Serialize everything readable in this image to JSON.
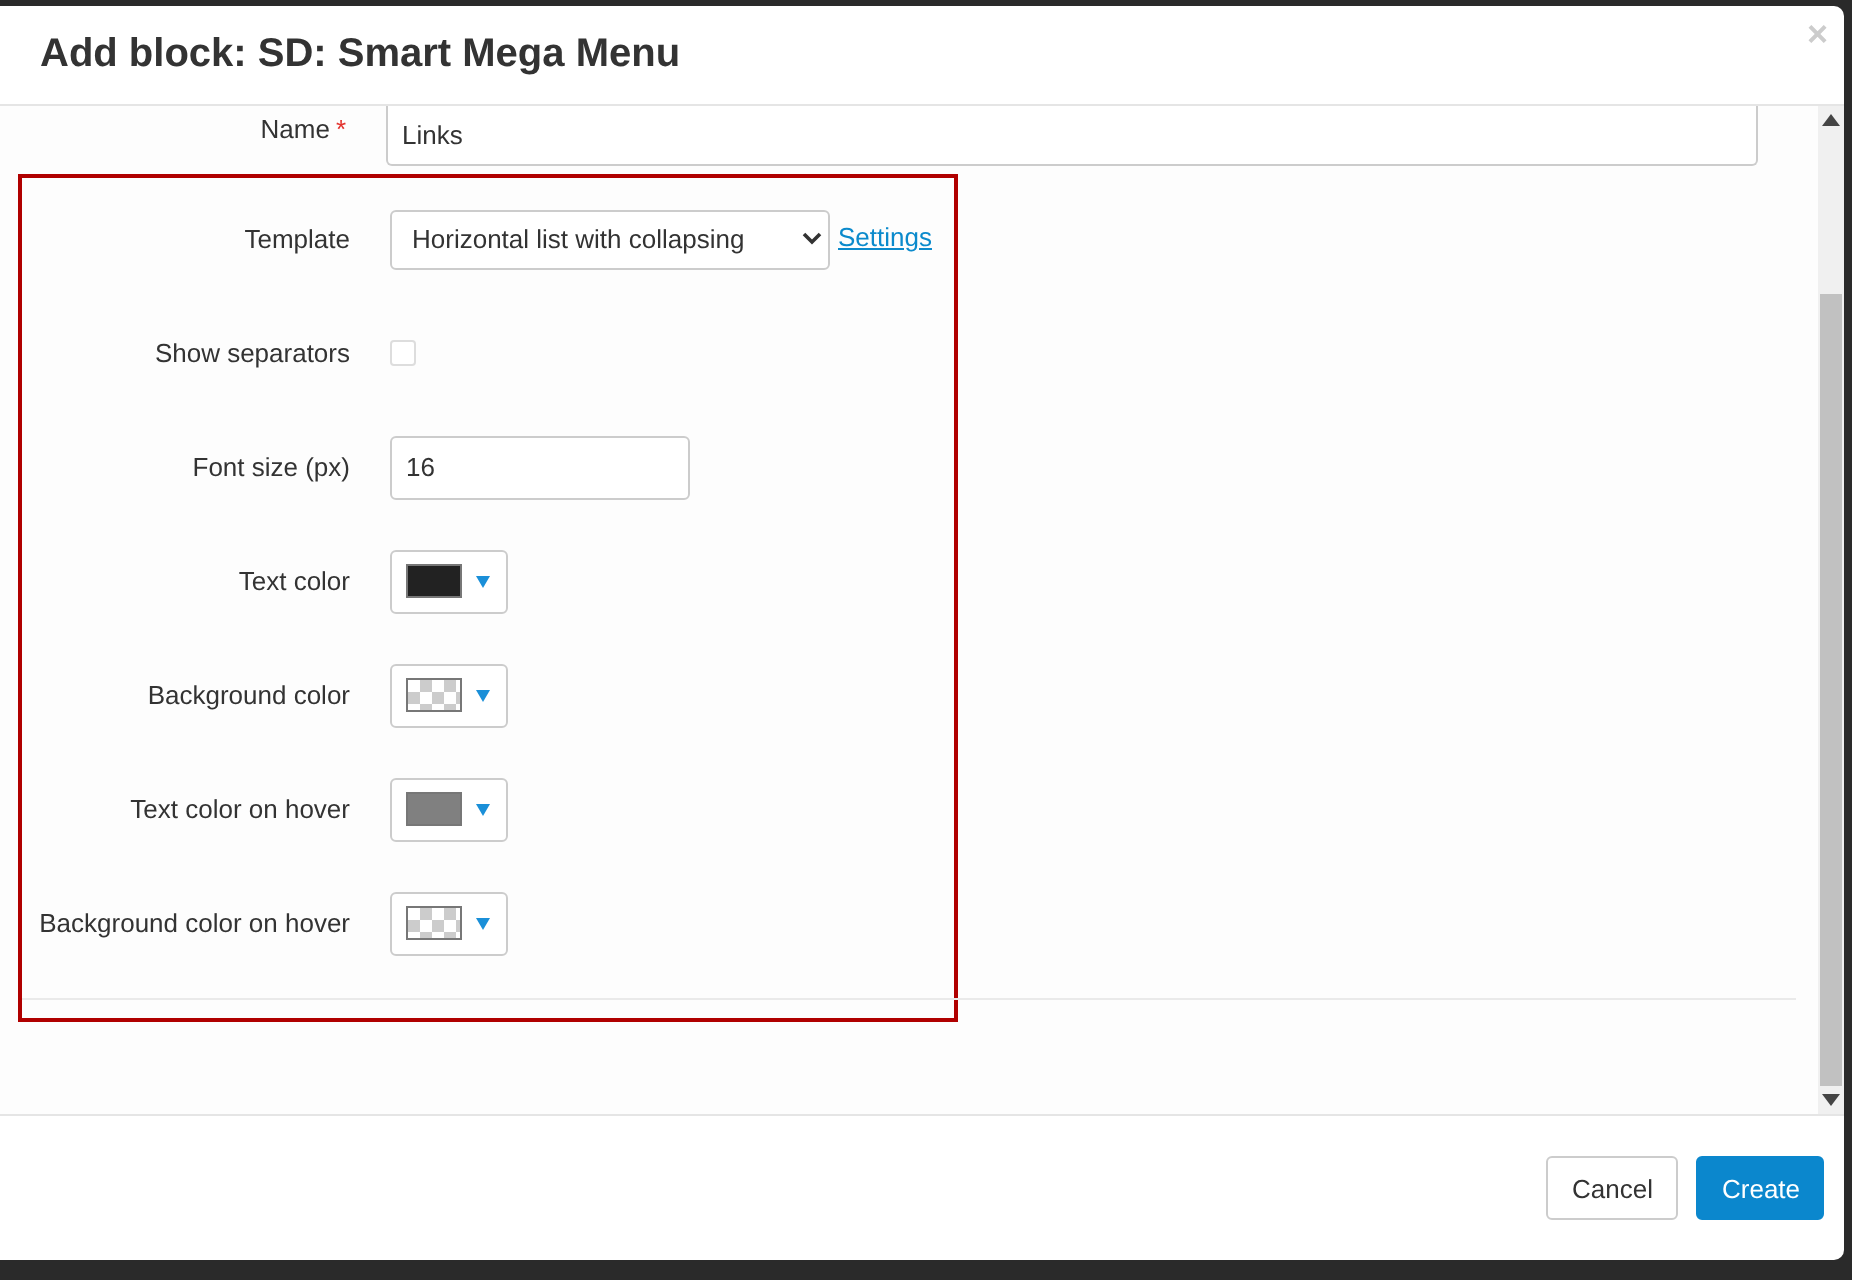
{
  "dialog": {
    "title": "Add block: SD: Smart Mega Menu",
    "close": "×"
  },
  "name_field": {
    "label": "Name",
    "required_mark": "*",
    "value": "Links"
  },
  "fields": [
    {
      "kind": "select",
      "label": "Template",
      "value": "Horizontal list with collapsing",
      "link": "Settings"
    },
    {
      "kind": "checkbox",
      "label": "Show separators",
      "checked": false
    },
    {
      "kind": "text",
      "label": "Font size (px)",
      "value": "16"
    },
    {
      "kind": "color",
      "label": "Text color",
      "transparent": false,
      "color": "#222222"
    },
    {
      "kind": "color",
      "label": "Background color",
      "transparent": true
    },
    {
      "kind": "color",
      "label": "Text color on hover",
      "transparent": false,
      "color": "#808080"
    },
    {
      "kind": "color",
      "label": "Background color on hover",
      "transparent": true
    }
  ],
  "buttons": [
    {
      "label": "Cancel",
      "kind": "secondary"
    },
    {
      "label": "Create",
      "kind": "primary"
    }
  ]
}
